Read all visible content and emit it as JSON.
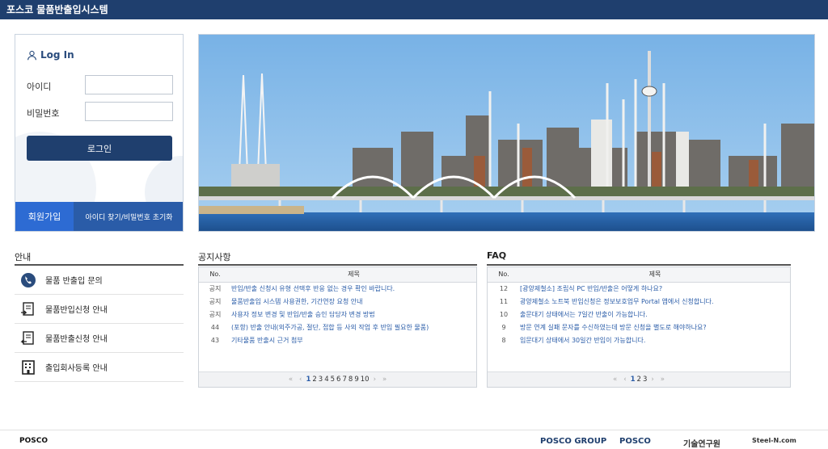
{
  "header": {
    "title": "포스코 물품반출입시스템"
  },
  "login": {
    "title": "Log In",
    "id_label": "아이디",
    "pw_label": "비밀번호",
    "id_value": "",
    "pw_value": "",
    "login_button": "로그인",
    "join_button": "회원가입",
    "find_link": "아이디 찾기/비밀번호 초기화"
  },
  "guide": {
    "title": "안내",
    "items": [
      {
        "label": "물품 반출입 문의",
        "icon": "phone-icon"
      },
      {
        "label": "물품반입신청 안내",
        "icon": "document-in-icon"
      },
      {
        "label": "물품반출신청 안내",
        "icon": "document-out-icon"
      },
      {
        "label": "출입회사등록 안내",
        "icon": "building-icon"
      }
    ]
  },
  "notice": {
    "title": "공지사항",
    "col_no": "No.",
    "col_title": "제목",
    "rows": [
      {
        "no": "공지",
        "title": "반입/반출 신청시 유형 선택후 반응 없는 경우 확인 바랍니다."
      },
      {
        "no": "공지",
        "title": "물품반출입 시스템 사용권한, 기간연장 요청 안내"
      },
      {
        "no": "공지",
        "title": "사용자 정보 변경 및 반입/반출 승인 담당자 변경 방법"
      },
      {
        "no": "44",
        "title": "(포항) 반출 안내(외주가공, 절단, 접합 등 사외 작업 후 반입 필요한 물품)"
      },
      {
        "no": "43",
        "title": "기타물품 반출시 근거 첨부"
      }
    ],
    "pages": [
      "1",
      "2",
      "3",
      "4",
      "5",
      "6",
      "7",
      "8",
      "9",
      "10"
    ],
    "current_page": "1"
  },
  "faq": {
    "title": "FAQ",
    "col_no": "No.",
    "col_title": "제목",
    "rows": [
      {
        "no": "12",
        "title": "[광양제철소] 조립식 PC 반입/반출은 어떻게 하나요?"
      },
      {
        "no": "11",
        "title": "광양제철소 노트북 반입신청은 정보보호업무 Portal 앱에서 신청합니다."
      },
      {
        "no": "10",
        "title": "출문대기 상태에서는 7일간 반출이 가능합니다."
      },
      {
        "no": "9",
        "title": "방문 연계 실패 문자를 수신하였는데 방문 신청을 별도로 해야하나요?"
      },
      {
        "no": "8",
        "title": "입문대기 상태에서 30일간 반입이 가능합니다."
      }
    ],
    "pages": [
      "1",
      "2",
      "3"
    ],
    "current_page": "1"
  },
  "footer": {
    "left": "POSCO",
    "links": [
      "POSCO GROUP",
      "POSCO",
      "기술연구원",
      "Steel-N.com"
    ]
  },
  "colors": {
    "header_bg": "#1f3f6e",
    "accent": "#2d6bd3",
    "link": "#2a5ca8"
  }
}
